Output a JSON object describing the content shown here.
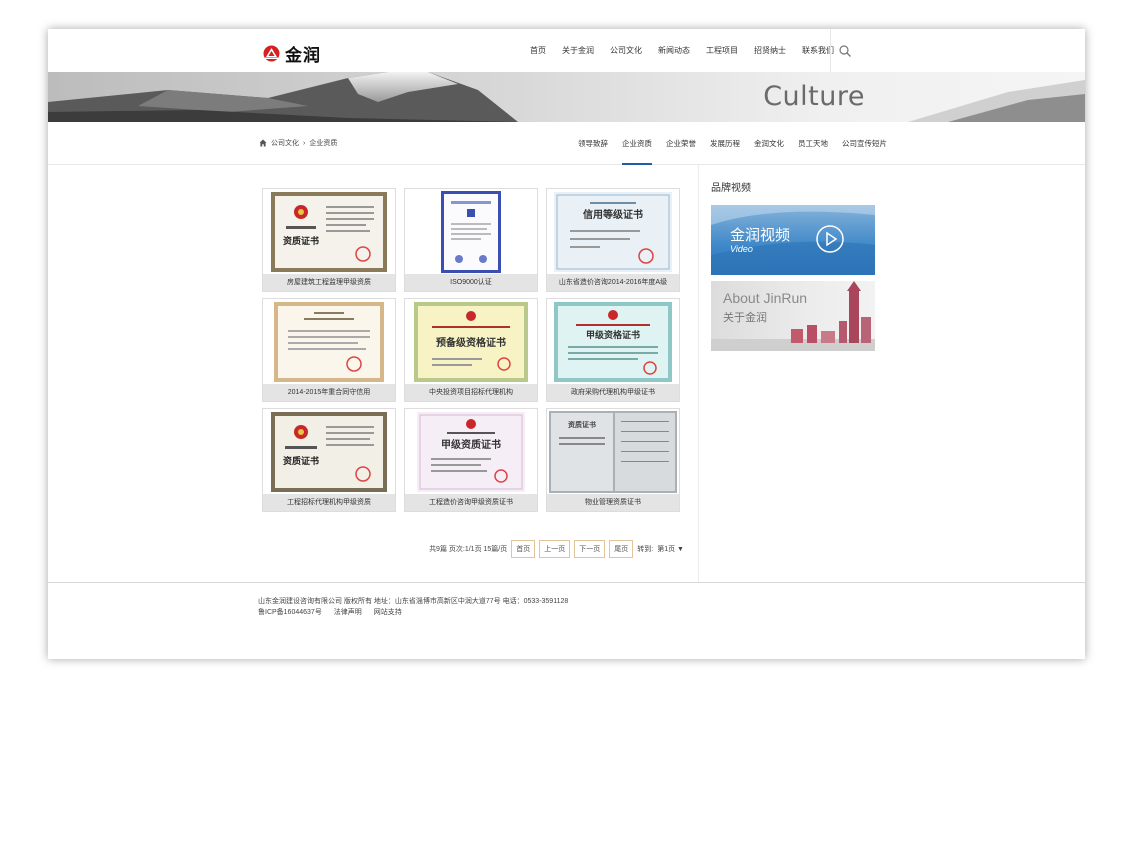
{
  "brand": {
    "logo_text": "金润",
    "logo_icon": "jinrun-logo-icon"
  },
  "nav": {
    "items": [
      "首页",
      "关于金润",
      "公司文化",
      "新闻动态",
      "工程项目",
      "招贤纳士",
      "联系我们"
    ],
    "search_icon": "search-icon"
  },
  "banner": {
    "title": "Culture"
  },
  "breadcrumb": {
    "home_icon": "home-icon",
    "items": [
      "公司文化",
      "企业资质"
    ],
    "separator": "›"
  },
  "subnav": {
    "tabs": [
      "领导致辞",
      "企业资质",
      "企业荣誉",
      "发展历程",
      "金润文化",
      "员工天地",
      "公司宣传短片"
    ],
    "active_index": 1,
    "accent_color": "#1c5fa8"
  },
  "certificates": [
    {
      "caption": "房屋建筑工程监理甲级资质",
      "doc_title": "资质证书"
    },
    {
      "caption": "ISO9000认证",
      "doc_title": ""
    },
    {
      "caption": "山东省造价咨询2014-2016年度A级",
      "doc_title": "信用等级证书"
    },
    {
      "caption": "2014-2015年重合同守信用",
      "doc_title": ""
    },
    {
      "caption": "中央投资项目招标代理机构",
      "doc_title": "预备级资格证书"
    },
    {
      "caption": "政府采购代理机构甲级证书",
      "doc_title": "甲级资格证书"
    },
    {
      "caption": "工程招标代理机构甲级资质",
      "doc_title": "资质证书"
    },
    {
      "caption": "工程造价咨询甲级资质证书",
      "doc_title": "甲级资质证书"
    },
    {
      "caption": "物业管理资质证书",
      "doc_title": "资质证书"
    }
  ],
  "pager": {
    "summary": "共9篇 页次:1/1页 15篇/页",
    "first": "首页",
    "prev": "上一页",
    "next": "下一页",
    "last": "尾页",
    "goto_label": "转到:",
    "goto_value": "第1页 ▼"
  },
  "sidebar": {
    "title": "品牌视频",
    "video_card": {
      "title": "金润视频",
      "subtitle": "Video",
      "icon": "play-circle-icon"
    },
    "about_card": {
      "title": "About JinRun",
      "subtitle": "关于金润"
    }
  },
  "footer": {
    "line1": "山东金润建设咨询有限公司 版权所有   地址：山东省淄博市高新区中润大道77号   电话：0533-3591128",
    "icp": "鲁ICP备16044637号",
    "legal": "法律声明",
    "support": "网站支持"
  }
}
